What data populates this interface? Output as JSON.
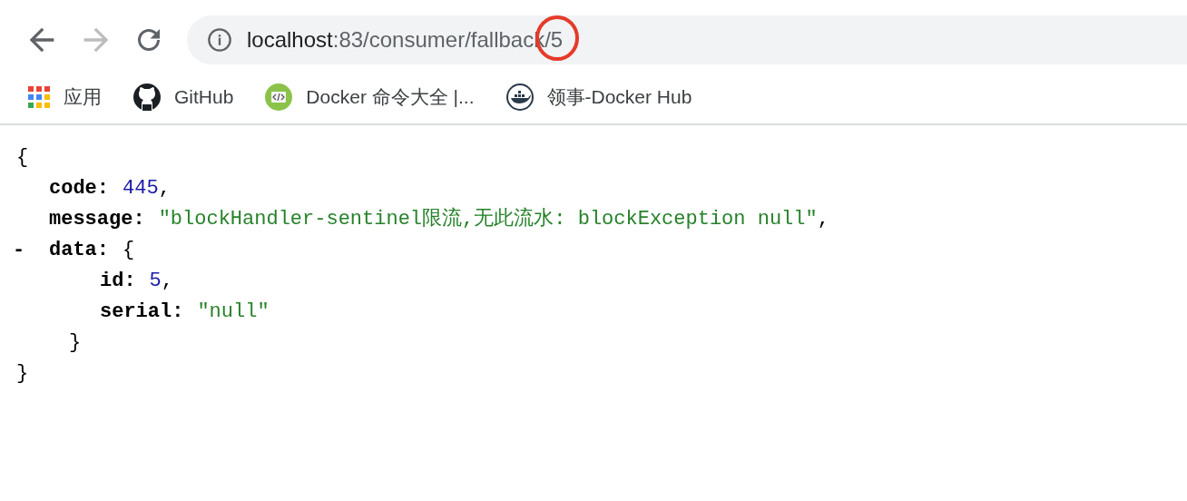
{
  "nav": {
    "back_disabled": false,
    "forward_disabled": true
  },
  "address": {
    "host": "localhost",
    "path": ":83/consumer/fallback/5"
  },
  "bookmarks": [
    {
      "kind": "apps",
      "label": "应用"
    },
    {
      "kind": "github",
      "label": "GitHub"
    },
    {
      "kind": "code",
      "label": "Docker 命令大全 |..."
    },
    {
      "kind": "whale",
      "label": "领事-Docker Hub"
    }
  ],
  "json_view": {
    "open": "{",
    "close": "}",
    "members": [
      {
        "key": "code:",
        "kind": "number",
        "value": "445",
        "suffix": ","
      },
      {
        "key": "message:",
        "kind": "string",
        "value": "\"blockHandler-sentinel限流,无此流水: blockException null\"",
        "suffix": ","
      },
      {
        "key": "data:",
        "kind": "object",
        "toggle": "-",
        "open": "{",
        "close": "}",
        "children": [
          {
            "key": "id:",
            "kind": "number",
            "value": "5",
            "suffix": ","
          },
          {
            "key": "serial:",
            "kind": "string",
            "value": "\"null\""
          }
        ]
      }
    ]
  }
}
